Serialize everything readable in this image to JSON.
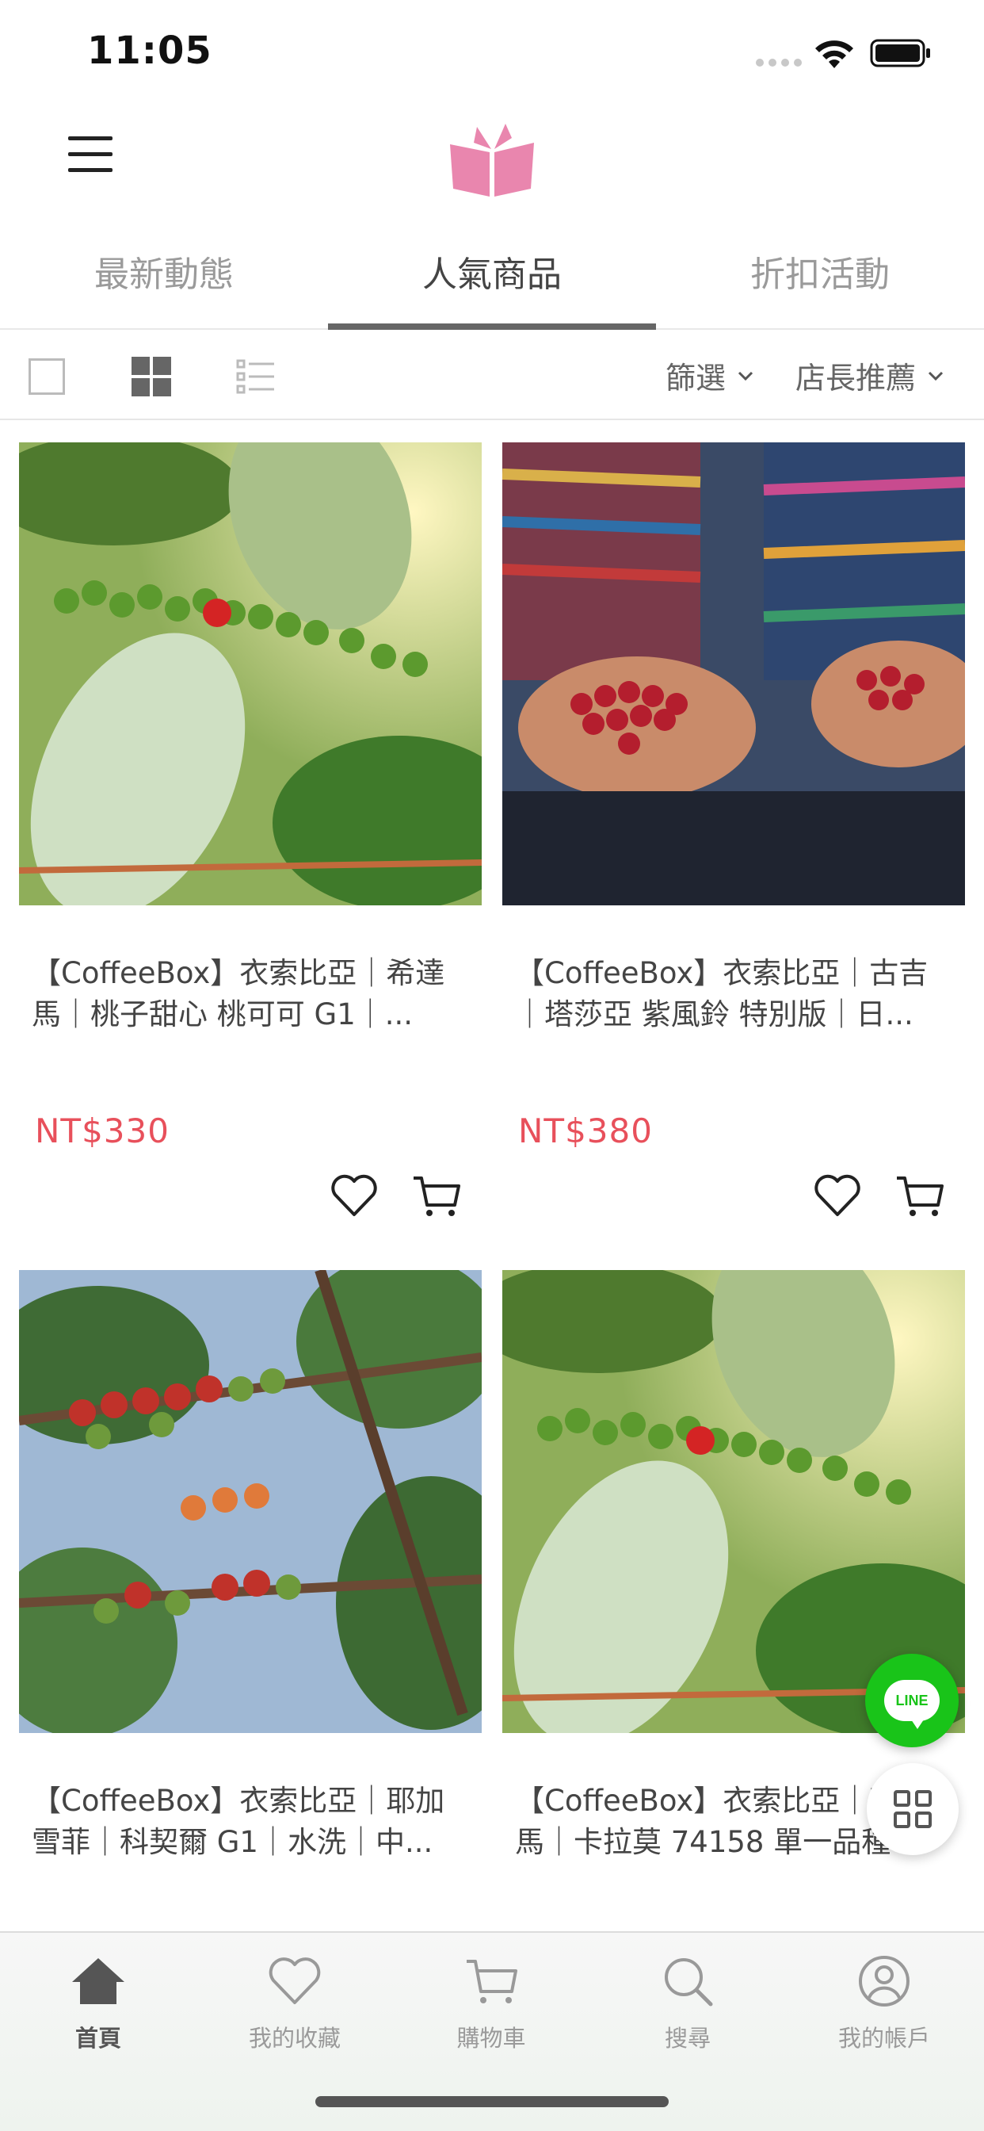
{
  "status_bar": {
    "time": "11:05"
  },
  "header": {
    "menu_icon": "hamburger-menu-icon",
    "logo_icon": "book-gift-logo-icon",
    "logo_color": "#e986ae"
  },
  "tabs": [
    {
      "label": "最新動態",
      "active": false
    },
    {
      "label": "人氣商品",
      "active": true
    },
    {
      "label": "折扣活動",
      "active": false
    }
  ],
  "toolbar": {
    "views": [
      "single-view-icon",
      "grid-view-icon",
      "list-view-icon"
    ],
    "active_view": "grid",
    "filter_label": "篩選",
    "sort_label": "店長推薦"
  },
  "products": [
    {
      "title": "【CoffeeBox】衣索比亞｜希達馬｜桃子甜心 桃可可 G1｜...",
      "price": "NT$330"
    },
    {
      "title": "【CoffeeBox】衣索比亞｜古吉｜塔莎亞 紫風鈴 特別版｜日...",
      "price": "NT$380"
    },
    {
      "title": "【CoffeeBox】衣索比亞｜耶加雪菲｜科契爾 G1｜水洗｜中...",
      "price": ""
    },
    {
      "title": "【CoffeeBox】衣索比亞｜西達馬｜卡拉莫 74158 單一品種",
      "price": ""
    }
  ],
  "floating": {
    "line_label": "LINE",
    "line_color": "#19c419"
  },
  "bottom_nav": [
    {
      "label": "首頁",
      "icon": "home-icon",
      "active": true
    },
    {
      "label": "我的收藏",
      "icon": "heart-icon",
      "active": false
    },
    {
      "label": "購物車",
      "icon": "cart-icon",
      "active": false
    },
    {
      "label": "搜尋",
      "icon": "search-icon",
      "active": false
    },
    {
      "label": "我的帳戶",
      "icon": "account-icon",
      "active": false
    }
  ],
  "colors": {
    "price": "#e8505b",
    "accent": "#666666"
  }
}
